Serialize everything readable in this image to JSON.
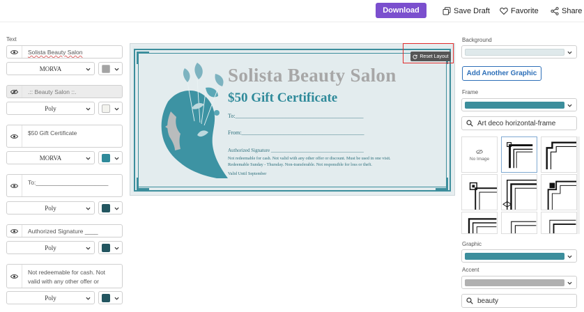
{
  "topbar": {
    "download_label": "Download",
    "save_draft_label": "Save Draft",
    "favorite_label": "Favorite",
    "share_label": "Share",
    "download_color": "#7b4fce"
  },
  "left_panel": {
    "section_title": "Text",
    "layers": [
      {
        "text": "Solista Beauty Salon",
        "font": "MORVA",
        "color": "#a3a3a3",
        "visible": true
      },
      {
        "text": ".:: Beauty Salon ::.",
        "font": "Poly",
        "color": "#f3f3ee",
        "visible": false
      },
      {
        "text": "$50 Gift Certificate",
        "font": "MORVA",
        "color": "#2f8a9a",
        "visible": true
      },
      {
        "text": "To:______________________",
        "font": "Poly",
        "color": "#235660",
        "visible": true
      },
      {
        "text": "Authorized Signature ____",
        "font": "Poly",
        "color": "#235660",
        "visible": true
      },
      {
        "text": "Not redeemable for cash. Not valid with any other offer or discount. Must be",
        "font": "Poly",
        "color": "#235660",
        "visible": true
      }
    ]
  },
  "canvas": {
    "reset_layout_label": "Reset Layout",
    "title": "Solista Beauty Salon",
    "subtitle": "$50 Gift Certificate",
    "to_line": "To:______________________________________________",
    "from_line": "From:____________________________________________",
    "signature_line": "Authorized Signature ______________________________________",
    "fine_print_1": "Not redeemable for cash. Not valid with any other offer or discount. Must be used in one visit.",
    "fine_print_2": "Redeemable Sunday - Thursday. Non-transferable. Not responsible for loss or theft.",
    "valid_until": "Valid Until September",
    "frame_color": "#3c8e9c",
    "background_color": "#e3ecee"
  },
  "right_panel": {
    "background_label": "Background",
    "background_color": "#dfe9eb",
    "add_graphic_label": "Add Another Graphic",
    "frame_label": "Frame",
    "frame_color": "#3c8e9c",
    "frame_search_value": "Art deco horizontal-frame",
    "no_image_label": "No Image",
    "graphic_label": "Graphic",
    "graphic_color": "#3c8e9c",
    "accent_label": "Accent",
    "accent_color": "#b0b0b0",
    "graphic_search_value": "beauty"
  }
}
